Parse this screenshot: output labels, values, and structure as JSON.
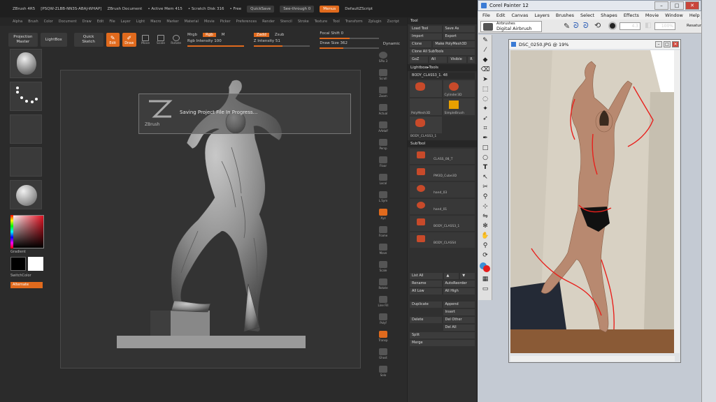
{
  "zbrush": {
    "title_items": [
      "ZBrush 4R5",
      "[PSQW-ZLBB-NN3S-ABAJ-WHAP]",
      "ZBrush Document",
      "• Active Mem 415",
      "• Scratch Disk 316",
      "• Free"
    ],
    "quicksave": "QuickSave",
    "see_through": "See-through 0",
    "menus_btn": "Menus",
    "default_zscript": "DefaultZScript",
    "menu_items": [
      "Alpha",
      "Brush",
      "Color",
      "Document",
      "Draw",
      "Edit",
      "File",
      "Layer",
      "Light",
      "Macro",
      "Marker",
      "Material",
      "Movie",
      "Picker",
      "Preferences",
      "Render",
      "Stencil",
      "Stroke",
      "Texture",
      "Tool",
      "Transform",
      "Zplugin",
      "Zscript"
    ],
    "toolbar": {
      "projection_master": "Projection Master",
      "lightbox": "LightBox",
      "quick_sketch": "Quick Sketch",
      "edit": "Edit",
      "draw": "Draw",
      "move": "Move",
      "scale": "Scale",
      "rotate": "Rotate",
      "mrgb": "Mrgb",
      "rgb": "Rgb",
      "m": "M",
      "rgb_intensity": "Rgb Intensity 100",
      "zadd": "Zadd",
      "zsub": "Zsub",
      "z_intensity": "Z Intensity 51",
      "focal_shift": "Focal Shift 0",
      "draw_size": "Draw Size 362",
      "dynamic": "Dynamic"
    },
    "left_shelf": {
      "material_label": "Matcap",
      "stroke_label": "Dots",
      "alpha_label": "Alpha Off",
      "texture_label": "Texture Off",
      "mat_label2": "SkinShade4",
      "gradient": "Gradient",
      "switch_color": "SwitchColor",
      "alternate": "Alternate"
    },
    "progress_message": "Saving Project File In Progress...",
    "progress_logo": "ZBrush",
    "right_shelf": [
      "SPix 3",
      "Scroll",
      "Zoom",
      "Actual",
      "AAHalf",
      "Persp",
      "Floor",
      "Local",
      "L.Sym",
      "Xyz",
      "Frame",
      "Move",
      "Scale",
      "Rotate",
      "Line Fill",
      "Polyf",
      "Transp",
      "Ghost",
      "Solo",
      "Xpose"
    ],
    "tool_panel": {
      "title": "Tool",
      "load_tool": "Load Tool",
      "save_as": "Save As",
      "import": "Import",
      "export": "Export",
      "clone": "Clone",
      "make_polymesh": "Make PolyMesh3D",
      "clone_all": "Clone All SubTools",
      "goz": "GoZ",
      "all": "All",
      "visible": "Visible",
      "r": "R",
      "lightbox_tools": "Lightbox▸Tools",
      "current_tool": "BODY_CLASS3_1. 48",
      "thumbs": [
        "BODY_CLASS3_1",
        "Cylinder3D",
        "PolyMesh3D",
        "SimpleBrush",
        "BODY_CLASS3_1"
      ],
      "subtool_header": "SubTool",
      "subtools": [
        "CLASS_08_T",
        "PM3D_Cube3D",
        "hand_03",
        "hand_01",
        "BODY_CLASS3_1",
        "BODY_CLASS4"
      ],
      "list_all": "List All",
      "rename": "Rename",
      "autoreorder": "AutoReorder",
      "all_low": "All Low",
      "all_high": "All High",
      "duplicate": "Duplicate",
      "append": "Append",
      "insert": "Insert",
      "delete": "Delete",
      "del_other": "Del Other",
      "del_all": "Del All",
      "split": "Split",
      "merge": "Merge"
    }
  },
  "painter": {
    "title": "Corel Painter 12",
    "menu_items": [
      "File",
      "Edit",
      "Canvas",
      "Layers",
      "Brushes",
      "Select",
      "Shapes",
      "Effects",
      "Movie",
      "Window",
      "Help"
    ],
    "brush_category": "Airbrushes",
    "brush_variant": "Digital Airbrush",
    "size_value": "4.3",
    "opacity_value": "100%",
    "resaturation_label": "Resaturation",
    "document_title": "DSC_0250.JPG @ 19%"
  }
}
